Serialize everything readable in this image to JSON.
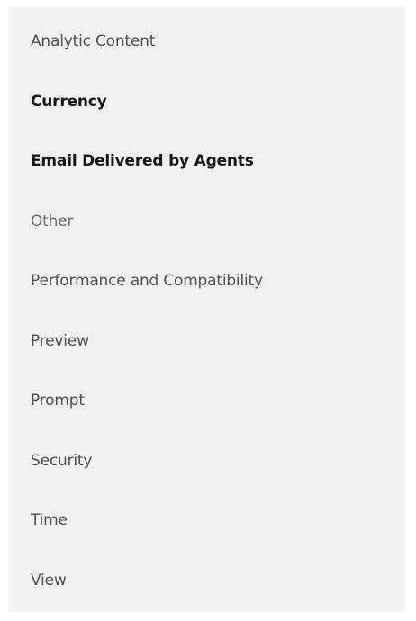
{
  "sidebar": {
    "items": [
      {
        "label": "Analytic Content",
        "style": "normal"
      },
      {
        "label": "Currency",
        "style": "strong"
      },
      {
        "label": "Email Delivered by Agents",
        "style": "strong"
      },
      {
        "label": "Other",
        "style": "muted"
      },
      {
        "label": "Performance and Compatibility",
        "style": "normal"
      },
      {
        "label": "Preview",
        "style": "normal"
      },
      {
        "label": "Prompt",
        "style": "normal"
      },
      {
        "label": "Security",
        "style": "normal"
      },
      {
        "label": "Time",
        "style": "normal"
      },
      {
        "label": "View",
        "style": "normal"
      }
    ],
    "colors": {
      "background": "#f1f1f1",
      "text": "#4f4f4f",
      "text_strong": "#161616",
      "text_muted": "#6b6b6b"
    }
  }
}
